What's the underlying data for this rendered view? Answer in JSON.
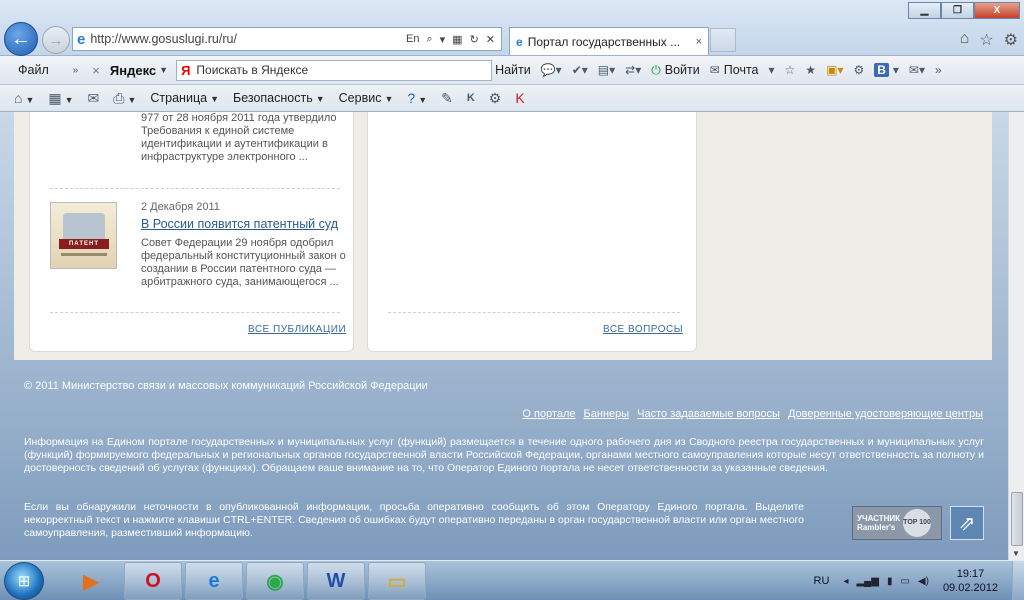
{
  "window": {
    "min": "▁",
    "max": "❐",
    "close": "X"
  },
  "address_bar": {
    "url": "http://www.gosuslugi.ru/ru/",
    "tools": [
      "En",
      "⌕",
      "▾",
      "▦",
      "↻",
      "✕"
    ]
  },
  "tab": {
    "title": "Портал государственных ...",
    "close": "×"
  },
  "menubar": {
    "file": "Файл",
    "chevron": "»",
    "yandex_close": "×",
    "yandex_logo": "Яндекс",
    "search_placeholder": "Поискать в Яндексе",
    "find": "Найти",
    "login": "Войти",
    "mail": "Почта"
  },
  "commandbar": {
    "page": "Страница",
    "security": "Безопасность",
    "service": "Сервис"
  },
  "publications": {
    "snippet_top": "977 от 28 ноября 2011 года утвердило Требования к единой системе идентификации и аутентификации в инфраструктуре электронного ...",
    "news": {
      "date": "2 Декабря 2011",
      "title": "В России появится патентный суд",
      "body": "Совет Федерации 29 ноября одобрил федеральный конституционный закон о создании в России патентного суда — арбитражного суда, занимающегося ...",
      "thumb_text": "ПАТЕНТ"
    },
    "all_link": "ВСЕ ПУБЛИКАЦИИ"
  },
  "questions": {
    "all_link": "ВСЕ ВОПРОСЫ"
  },
  "footer": {
    "copyright": "© 2011 Министерство связи и массовых коммуникаций Российской Федерации",
    "links": [
      "О портале",
      "Баннеры",
      "Часто задаваемые вопросы",
      "Доверенные удостоверяющие центры"
    ],
    "info_text": "Информация на Едином портале государственных и муниципальных услуг (функций) размещается в течение одного рабочего дня из Сводного реестра государственных и муниципальных услуг (функций) формируемого федеральных и региональных органов государственной власти Российской Федерации, органами местного самоуправления которые несут ответственность за полноту и достоверность сведений об услугах (функциях). Обращаем ваше внимание на то, что Оператор Единого портала не несет ответственности за указанные сведения.",
    "errors_text": "Если вы обнаружили неточности в опубликованной информации, просьба оперативно сообщить об этом Оператору Единого портала. Выделите некорректный текст и нажмите клавиши CTRL+ENTER. Сведения об ошибках будут оперативно переданы в орган государственной власти или орган местного самоуправления, разместивший информацию.",
    "rambler": {
      "line1": "УЧАСТНИК",
      "line2": "Rambler's",
      "badge": "TOP 100"
    }
  },
  "taskbar": {
    "language": "RU",
    "time": "19:17",
    "date": "09.02.2012",
    "apps": [
      "media-player",
      "opera",
      "internet-explorer",
      "chrome",
      "word",
      "explorer"
    ]
  }
}
